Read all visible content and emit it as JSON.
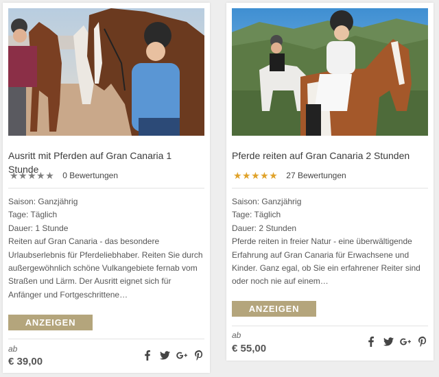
{
  "cards": [
    {
      "title": "Ausritt mit Pferden auf Gran Canaria 1 Stunde",
      "stars": "★★★★★",
      "rating_value": 0,
      "reviews": "0 Bewertungen",
      "saison": "Saison: Ganzjährig",
      "tage": "Tage: Täglich",
      "dauer": "Dauer: 1 Stunde",
      "description_lines": [
        "Reiten auf Gran Canaria - das besondere",
        "Urlaubserlebnis für Pferdeliebhaber. Reiten Sie durch",
        "außergewöhnlich schöne Vulkangebiete fernab vom",
        "Straßen und Lärm. Der Ausritt eignet sich für",
        "Anfänger und Fortgeschrittene…"
      ],
      "button": "ANZEIGEN",
      "price_prefix": "ab",
      "price": "€ 39,00"
    },
    {
      "title": "Pferde reiten auf Gran Canaria 2 Stunden",
      "stars": "★★★★★",
      "rating_value": 5,
      "reviews": "27 Bewertungen",
      "saison": "Saison: Ganzjährig",
      "tage": "Tage: Täglich",
      "dauer": "Dauer: 2 Stunden",
      "description_lines": [
        "Pferde reiten in freier Natur - eine überwältigende",
        "Erfahrung auf Gran Canaria für Erwachsene und",
        "Kinder. Ganz egal, ob Sie ein erfahrener Reiter sind",
        "oder noch nie auf einem…"
      ],
      "button": "ANZEIGEN",
      "price_prefix": "ab",
      "price": "€ 55,00"
    }
  ],
  "social_icons": [
    "facebook-icon",
    "twitter-icon",
    "google-plus-icon",
    "pinterest-icon"
  ],
  "colors": {
    "button": "#b4a57c",
    "star_gold": "#e0a22a",
    "star_grey": "#808080"
  }
}
